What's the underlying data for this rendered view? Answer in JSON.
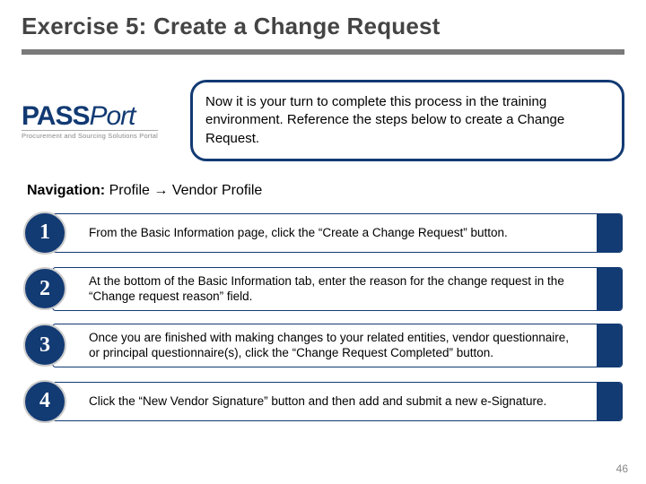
{
  "title": "Exercise 5: Create a Change Request",
  "logo": {
    "brand_left": "PASS",
    "brand_right": "Port",
    "tagline": "Procurement and Sourcing Solutions Portal"
  },
  "intro": "Now it is your turn to complete this process in the training environment. Reference the steps below to create a Change Request.",
  "navigation": {
    "label": "Navigation:",
    "path": "Profile → Vendor Profile"
  },
  "steps": [
    {
      "num": "1",
      "text": "From the Basic Information page, click the “Create a Change Request” button."
    },
    {
      "num": "2",
      "text": "At the bottom of the Basic Information tab, enter the reason for the change request in the “Change request reason” field."
    },
    {
      "num": "3",
      "text": "Once you are finished with making changes to your related entities, vendor questionnaire, or principal questionnaire(s), click the “Change Request Completed” button."
    },
    {
      "num": "4",
      "text": "Click the “New Vendor Signature” button and then add and submit a new e-Signature."
    }
  ],
  "page_number": "46"
}
